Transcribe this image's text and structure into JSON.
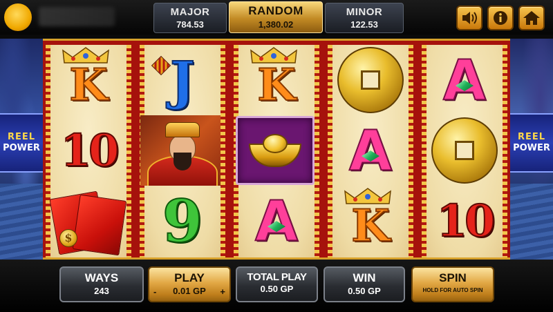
{
  "jackpots": {
    "major": {
      "label": "MAJOR",
      "value": "784.53"
    },
    "random": {
      "label": "RANDOM",
      "value": "1,380.02"
    },
    "minor": {
      "label": "MINOR",
      "value": "122.53"
    }
  },
  "top_buttons": {
    "sound_icon": "speaker-icon",
    "info_icon": "info-icon",
    "home_icon": "home-icon"
  },
  "side_banner": {
    "line1": "REEL",
    "line2": "POWER"
  },
  "reels": [
    [
      {
        "symbol": "K",
        "label": "K"
      },
      {
        "symbol": "10",
        "label": "10"
      },
      {
        "symbol": "red-envelopes",
        "label": "$"
      }
    ],
    [
      {
        "symbol": "J",
        "label": "J"
      },
      {
        "symbol": "fortune-god",
        "label": ""
      },
      {
        "symbol": "9",
        "label": "9"
      }
    ],
    [
      {
        "symbol": "K",
        "label": "K"
      },
      {
        "symbol": "gold-ingot",
        "label": ""
      },
      {
        "symbol": "A",
        "label": "A"
      }
    ],
    [
      {
        "symbol": "gold-coin",
        "label": ""
      },
      {
        "symbol": "A",
        "label": "A"
      },
      {
        "symbol": "K",
        "label": "K"
      }
    ],
    [
      {
        "symbol": "A",
        "label": "A"
      },
      {
        "symbol": "gold-coin",
        "label": ""
      },
      {
        "symbol": "10",
        "label": "10"
      }
    ]
  ],
  "bottom": {
    "ways": {
      "label": "WAYS",
      "value": "243"
    },
    "play": {
      "label": "PLAY",
      "value": "0.01 GP",
      "minus": "-",
      "plus": "+"
    },
    "total_play": {
      "label": "TOTAL PLAY",
      "value": "0.50 GP"
    },
    "win": {
      "label": "WIN",
      "value": "0.50 GP"
    },
    "spin": {
      "label": "SPIN",
      "hint": "HOLD FOR AUTO SPIN"
    }
  },
  "colors": {
    "accent_gold": "#e2a845",
    "reel_border_red": "#a6120c",
    "panel_gray": "#2a2d32"
  }
}
